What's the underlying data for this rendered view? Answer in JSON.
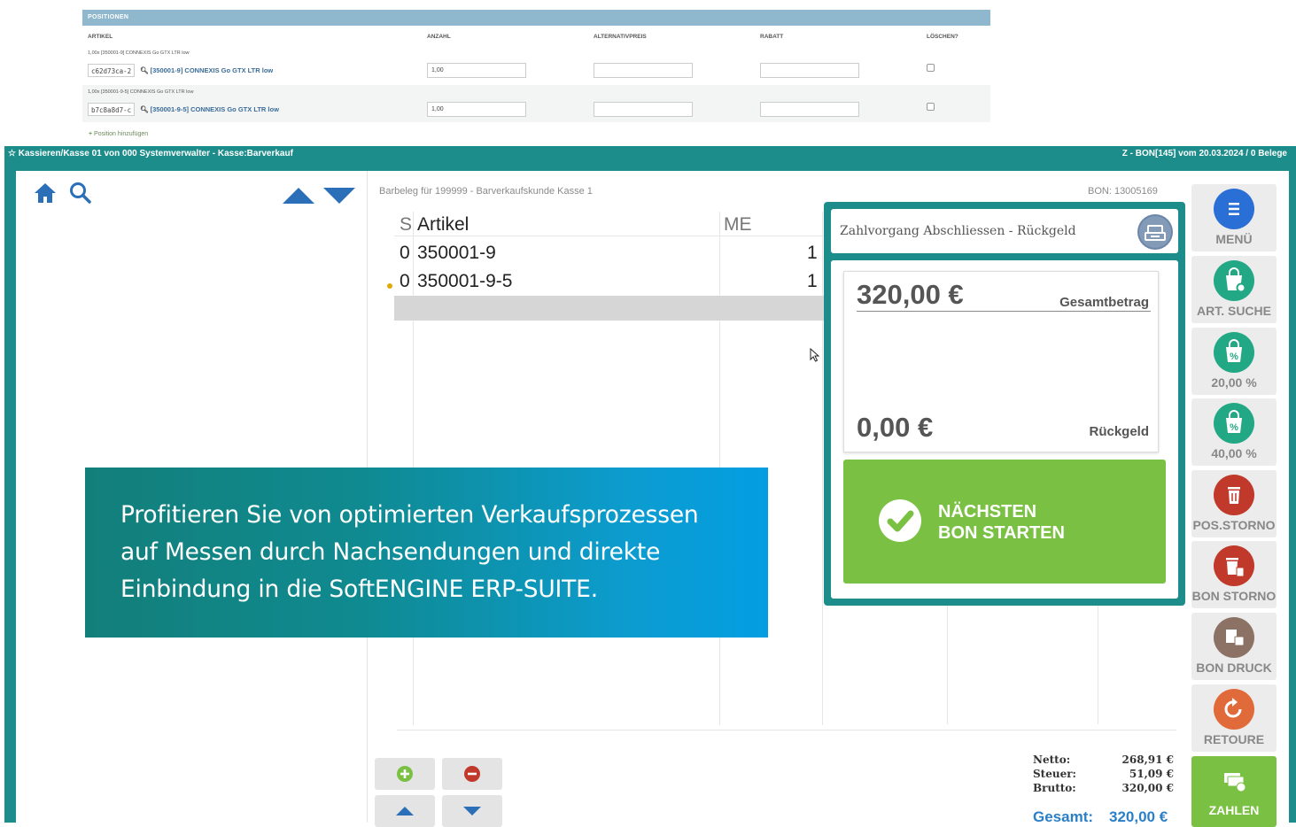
{
  "form": {
    "header": "POSITIONEN",
    "columns": [
      "ARTIKEL",
      "ANZAHL",
      "ALTERNATIVPREIS",
      "RABATT",
      "LÖSCHEN?"
    ],
    "rows": [
      {
        "caption": "1,00x [350001-9] CONNEXIS Go GTX LTR low",
        "id": "c62d73ca-2",
        "article": "[350001-9] CONNEXIS Go GTX LTR low",
        "qty": "1,00"
      },
      {
        "caption": "1,00x [350001-9-5] CONNEXIS Go GTX LTR low",
        "id": "b7c8a8d7-c",
        "article": "[350001-9-5] CONNEXIS Go GTX LTR low",
        "qty": "1,00"
      }
    ],
    "add_label": "Position hinzufügen"
  },
  "pos": {
    "title_left": "Kassieren/Kasse 01 von 000 Systemverwalter - Kasse:Barverkauf",
    "title_right": "Z - BON[145] vom 20.03.2024 / 0 Belege",
    "receipt_info": "Barbeleg für 199999 - Barverkaufskunde Kasse 1",
    "bon_number": "BON: 13005169",
    "table": {
      "headers": {
        "s": "S",
        "artikel": "Artikel",
        "me": "ME"
      },
      "rows": [
        {
          "s": "0",
          "artikel": "350001-9",
          "me": "1"
        },
        {
          "s": "0",
          "artikel": "350001-9-5",
          "me": "1"
        }
      ]
    },
    "payment": {
      "title": "Zahlvorgang Abschliessen - Rückgeld",
      "total_amount": "320,00 €",
      "total_label": "Gesamtbetrag",
      "change_amount": "0,00 €",
      "change_label": "Rückgeld",
      "next_line1": "NÄCHSTEN",
      "next_line2": "BON STARTEN"
    },
    "toolbar": [
      {
        "label": "MENÜ",
        "icon": "menu-icon",
        "color": "#2a6fd6"
      },
      {
        "label": "ART. SUCHE",
        "icon": "bag-search-icon",
        "color": "#22a884"
      },
      {
        "label": "20,00 %",
        "icon": "percent-bag-icon",
        "color": "#22a884"
      },
      {
        "label": "40,00 %",
        "icon": "percent-bag-icon",
        "color": "#22a884"
      },
      {
        "label": "POS.STORNO",
        "icon": "trash-icon",
        "color": "#c0392b"
      },
      {
        "label": "BON STORNO",
        "icon": "trash-receipt-icon",
        "color": "#c0392b"
      },
      {
        "label": "BON DRUCK",
        "icon": "print-icon",
        "color": "#8b7265"
      },
      {
        "label": "RETOURE",
        "icon": "return-icon",
        "color": "#e06a3a"
      },
      {
        "label": "ZAHLEN",
        "icon": "pay-icon",
        "color": "#7ac143"
      }
    ],
    "totals": {
      "netto_label": "Netto:",
      "netto": "268,91 €",
      "steuer_label": "Steuer:",
      "steuer": "51,09 €",
      "brutto_label": "Brutto:",
      "brutto": "320,00 €",
      "gesamt_label": "Gesamt:",
      "gesamt": "320,00 €"
    }
  },
  "promo": {
    "line1": "Profitieren Sie von optimierten Verkaufsprozessen",
    "line2": "auf Messen durch Nachsendungen und direkte",
    "line3": "Einbindung in die SoftENGINE ERP-SUITE."
  }
}
